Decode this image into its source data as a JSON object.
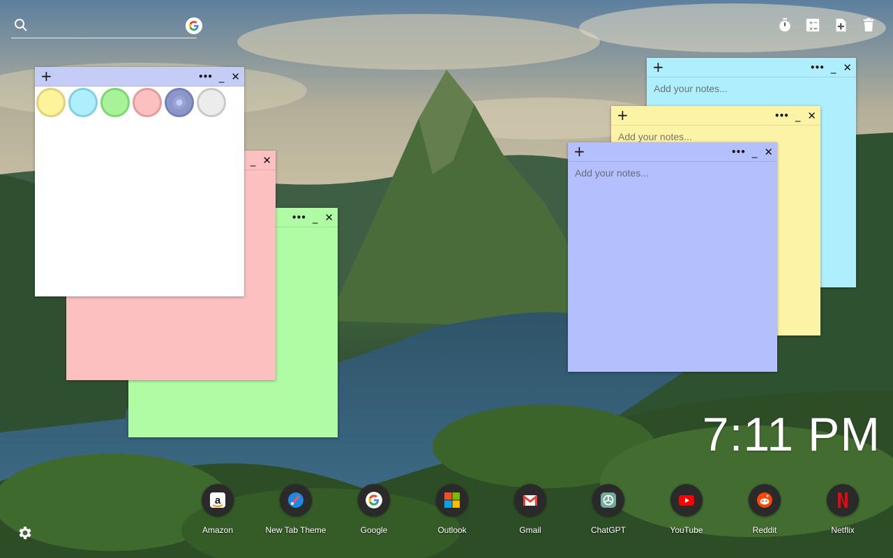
{
  "colors": {
    "yellow_note": "#fdf3a7",
    "cyan_note": "#aeeefd",
    "purple_note": "#b4c0fd",
    "pink_note": "#fdc0c0",
    "green_note": "#b0fca4",
    "white_note": "#ffffff"
  },
  "search": {
    "placeholder": "",
    "icon": "search-icon",
    "engine_icon": "google-icon"
  },
  "toolbar": {
    "icons": [
      "timer-icon",
      "calculator-icon",
      "new-note-icon",
      "trash-icon"
    ]
  },
  "notes": {
    "placeholder": "Add your notes...",
    "plus_label": "+",
    "menu_label": "•••",
    "minimize_label": "_",
    "close_label": "✕"
  },
  "color_picker": {
    "swatches": [
      {
        "fill": "#fdf39a",
        "border": "#e0d27a"
      },
      {
        "fill": "#aeeefd",
        "border": "#82cfe0"
      },
      {
        "fill": "#a8f29a",
        "border": "#7fd572"
      },
      {
        "fill": "#fdc0c0",
        "border": "#e49c9c"
      },
      {
        "fill": "#8c96c8",
        "border": "#7480b8"
      },
      {
        "fill": "#ececec",
        "border": "#c9c9c9"
      }
    ]
  },
  "clock": {
    "time": "7:11 PM"
  },
  "dock": {
    "apps": [
      {
        "label": "Amazon",
        "icon": "amazon-icon"
      },
      {
        "label": "New Tab Theme",
        "icon": "new-tab-theme-icon"
      },
      {
        "label": "Google",
        "icon": "google-icon"
      },
      {
        "label": "Outlook",
        "icon": "microsoft-icon"
      },
      {
        "label": "Gmail",
        "icon": "gmail-icon"
      },
      {
        "label": "ChatGPT",
        "icon": "chatgpt-icon"
      },
      {
        "label": "YouTube",
        "icon": "youtube-icon"
      },
      {
        "label": "Reddit",
        "icon": "reddit-icon"
      },
      {
        "label": "Netflix",
        "icon": "netflix-icon"
      }
    ]
  },
  "settings": {
    "icon": "gear-icon"
  }
}
